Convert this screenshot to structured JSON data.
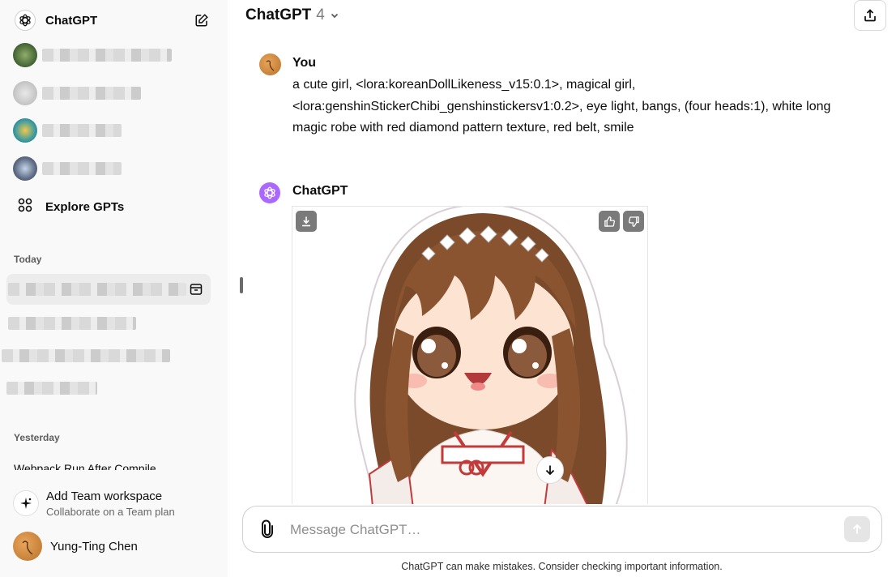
{
  "sidebar": {
    "title": "ChatGPT",
    "explore_label": "Explore GPTs",
    "sections": {
      "today": "Today",
      "yesterday": "Yesterday"
    },
    "yesterday_item": "Webpack Run After Compile",
    "team": {
      "title": "Add Team workspace",
      "subtitle": "Collaborate on a Team plan"
    },
    "user_name": "Yung-Ting Chen"
  },
  "header": {
    "model_name": "ChatGPT",
    "model_version": "4"
  },
  "conversation": {
    "user_author": "You",
    "user_message": "a cute girl, <lora:koreanDollLikeness_v15:0.1>, magical girl, <lora:genshinStickerChibi_genshinstickersv1:0.2>, eye light, bangs, (four heads:1), white long magic robe with red diamond pattern texture, red belt, smile",
    "assistant_author": "ChatGPT"
  },
  "composer": {
    "placeholder": "Message ChatGPT…"
  },
  "footer": {
    "disclaimer": "ChatGPT can make mistakes. Consider checking important information."
  },
  "icons": {
    "logo": "openai-logo-icon",
    "new_chat": "edit-icon",
    "explore": "grid-icon",
    "archive": "archive-icon",
    "share": "share-icon",
    "download": "download-icon",
    "thumbs_up": "thumbs-up-icon",
    "thumbs_down": "thumbs-down-icon",
    "scroll": "arrow-down-icon",
    "attach": "paperclip-icon",
    "send": "arrow-up-icon",
    "team": "sparkle-icon"
  },
  "colors": {
    "sidebar_bg": "#f9f9f9",
    "assistant_avatar": "#ab68ff",
    "active_item": "#ececec"
  }
}
